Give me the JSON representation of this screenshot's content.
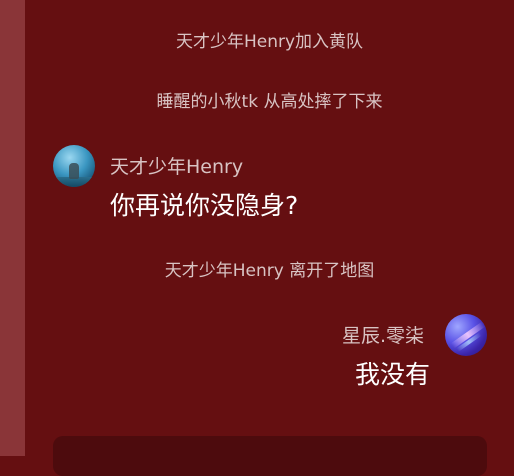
{
  "system_messages": [
    "天才少年Henry加入黄队",
    "睡醒的小秋tk 从高处摔了下来",
    "天才少年Henry 离开了地图"
  ],
  "messages": [
    {
      "sender": "天才少年Henry",
      "text": "你再说你没隐身?",
      "side": "left"
    },
    {
      "sender": "星辰.零柒",
      "text": "我没有",
      "side": "right"
    }
  ],
  "colors": {
    "background": "#650f11",
    "left_strip": "#8a3538",
    "system_text": "#d8c3c3",
    "message_text": "#ffffff",
    "input_bar": "#4d0b0d"
  }
}
